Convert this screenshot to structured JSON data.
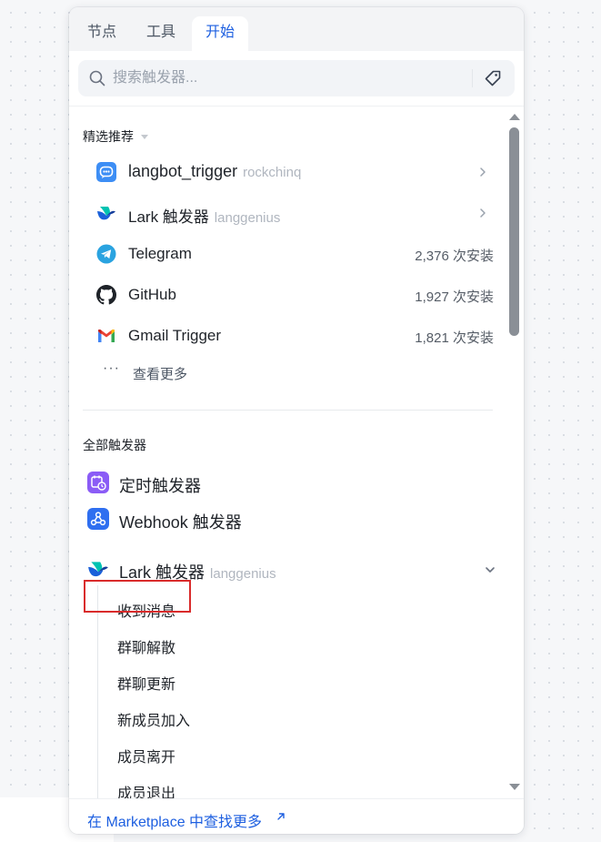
{
  "tabs": [
    {
      "label": "节点"
    },
    {
      "label": "工具"
    },
    {
      "label": "开始",
      "active": true
    }
  ],
  "search": {
    "placeholder": "搜索触发器..."
  },
  "featured": {
    "title": "精选推荐",
    "items": [
      {
        "name": "langbot_trigger",
        "org": "rockchinq",
        "icon": "langbot-icon"
      },
      {
        "name": "Lark 触发器",
        "org": "langgenius",
        "icon": "lark-icon"
      },
      {
        "name": "Telegram",
        "installs": "2,376 次安装",
        "icon": "telegram-icon"
      },
      {
        "name": "GitHub",
        "installs": "1,927 次安装",
        "icon": "github-icon"
      },
      {
        "name": "Gmail Trigger",
        "installs": "1,821 次安装",
        "icon": "gmail-icon"
      }
    ],
    "more_label": "查看更多",
    "more_dots": "···"
  },
  "all_triggers": {
    "title": "全部触发器",
    "items": [
      {
        "name": "定时触发器",
        "icon": "schedule-icon"
      },
      {
        "name": "Webhook 触发器",
        "icon": "webhook-icon"
      },
      {
        "name": "Lark 触发器",
        "org": "langgenius",
        "icon": "lark-icon",
        "expanded": true
      }
    ],
    "lark_events": [
      "收到消息",
      "群聊解散",
      "群聊更新",
      "新成员加入",
      "成员离开",
      "成员退出"
    ]
  },
  "footer": {
    "link_label": "在 Marketplace 中查找更多"
  },
  "colors": {
    "accent": "#1d5fe0",
    "highlight": "#d92b2b"
  }
}
